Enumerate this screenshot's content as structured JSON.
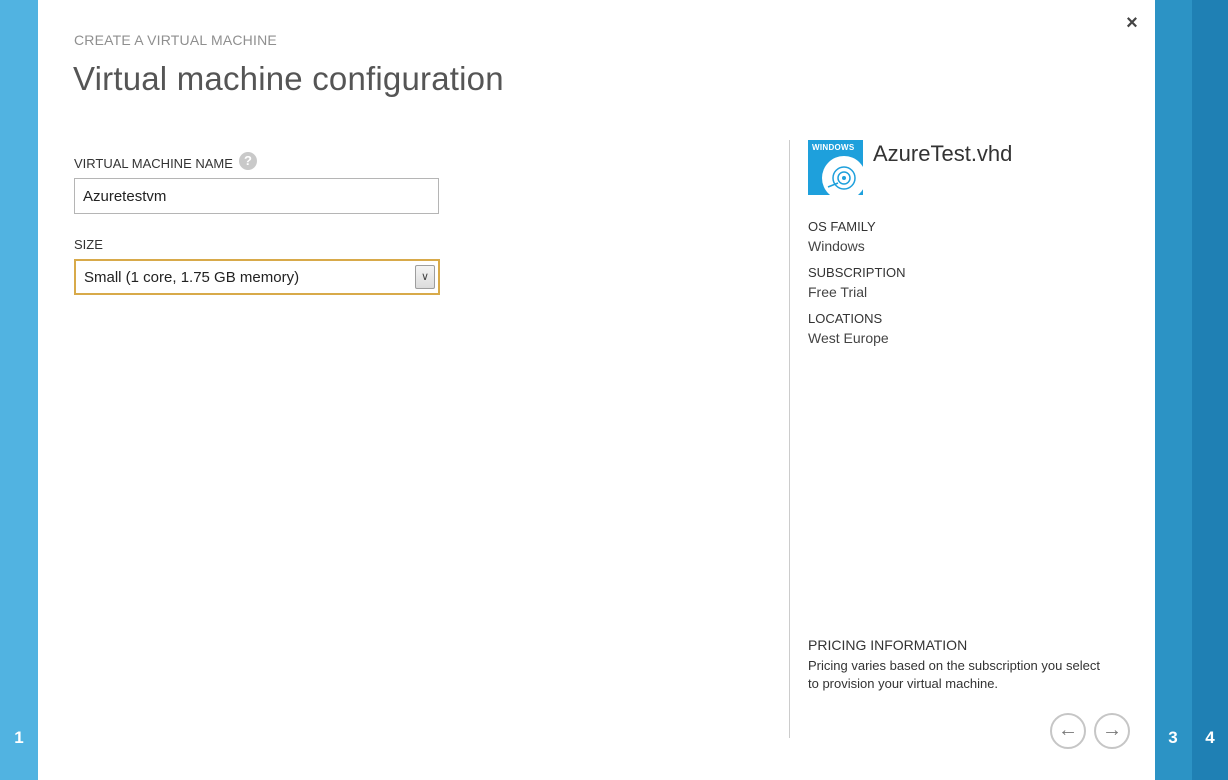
{
  "wizard": {
    "steps": {
      "left": "1",
      "right_a": "3",
      "right_b": "4"
    },
    "close_label": "×",
    "subtitle": "CREATE A VIRTUAL MACHINE",
    "title": "Virtual machine configuration"
  },
  "form": {
    "name_label": "VIRTUAL MACHINE NAME",
    "help_label": "?",
    "name_value": "Azuretestvm",
    "size_label": "SIZE",
    "size_value": "Small (1 core, 1.75 GB memory)",
    "size_arrow": "∨"
  },
  "image": {
    "badge": "WINDOWS",
    "icon": "disk-icon",
    "name": "AzureTest.vhd",
    "os_family_label": "OS FAMILY",
    "os_family_value": "Windows",
    "subscription_label": "SUBSCRIPTION",
    "subscription_value": "Free Trial",
    "locations_label": "LOCATIONS",
    "locations_value": "West Europe"
  },
  "pricing": {
    "heading": "PRICING INFORMATION",
    "text": "Pricing varies based on the subscription you select to provision your virtual machine."
  },
  "nav": {
    "prev_label": "←",
    "next_label": "→"
  },
  "colors": {
    "rail_active": "#51b3e1",
    "rail_step3": "#2c93c5",
    "rail_step4": "#1f80b4",
    "focus_border": "#d8aa4a",
    "os_tile": "#1ea0dc"
  }
}
